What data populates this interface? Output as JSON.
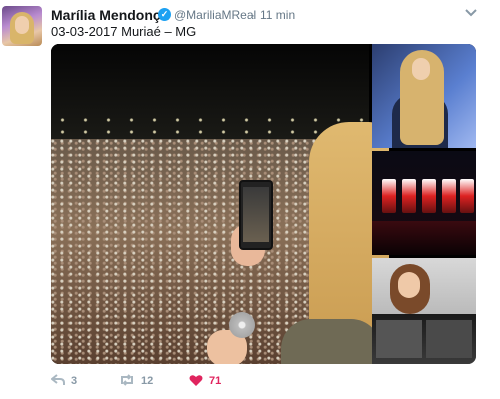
{
  "tweet": {
    "author_name": "Marília Mendonça",
    "handle": "@MariliaMReal",
    "separator": "·",
    "time": "11 min",
    "text": "03-03-2017 Muriaé – MG",
    "verified_icon": "verified-badge-icon",
    "menu_icon": "chevron-down-icon"
  },
  "actions": {
    "reply": {
      "icon": "reply-icon",
      "count": "3"
    },
    "retweet": {
      "icon": "retweet-icon",
      "count": "12"
    },
    "like": {
      "icon": "heart-icon",
      "count": "71"
    }
  },
  "colors": {
    "verified": "#1da1f2",
    "like": "#e0245e",
    "muted": "#657786"
  }
}
